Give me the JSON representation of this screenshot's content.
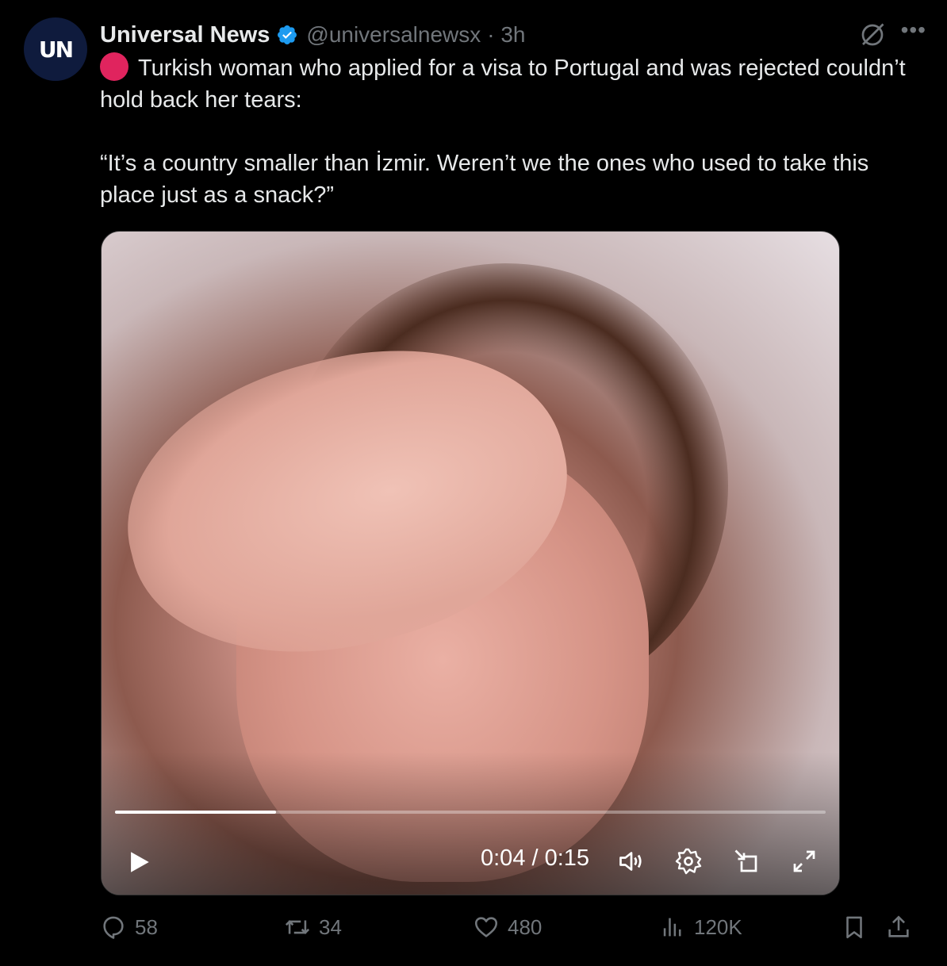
{
  "author": {
    "avatar_text": "UN",
    "name": "Universal News",
    "handle": "@universalnewsx",
    "time": "· 3h"
  },
  "icons": {
    "verified": "verified-badge-icon",
    "grok": "grok-icon",
    "more": "more-icon",
    "status_dot": "red-circle-icon"
  },
  "post": {
    "line1": "Turkish woman who applied for a visa to Portugal and was rejected couldn’t hold back her tears:",
    "line2": "“It’s a country smaller than İzmir. Weren’t we the ones who used to take this place just as a snack?”"
  },
  "video": {
    "current_time": "0:04",
    "separator": "/",
    "duration": "0:15",
    "time_display": "0:04 / 0:15",
    "progress": 0.2267
  },
  "actions": {
    "replies": "58",
    "reposts": "34",
    "likes": "480",
    "views": "120K"
  },
  "colors": {
    "accent": "#1d9bf0",
    "secondary_text": "#71767b",
    "primary_text": "#e7e9ea",
    "dot": "#e0245e"
  }
}
